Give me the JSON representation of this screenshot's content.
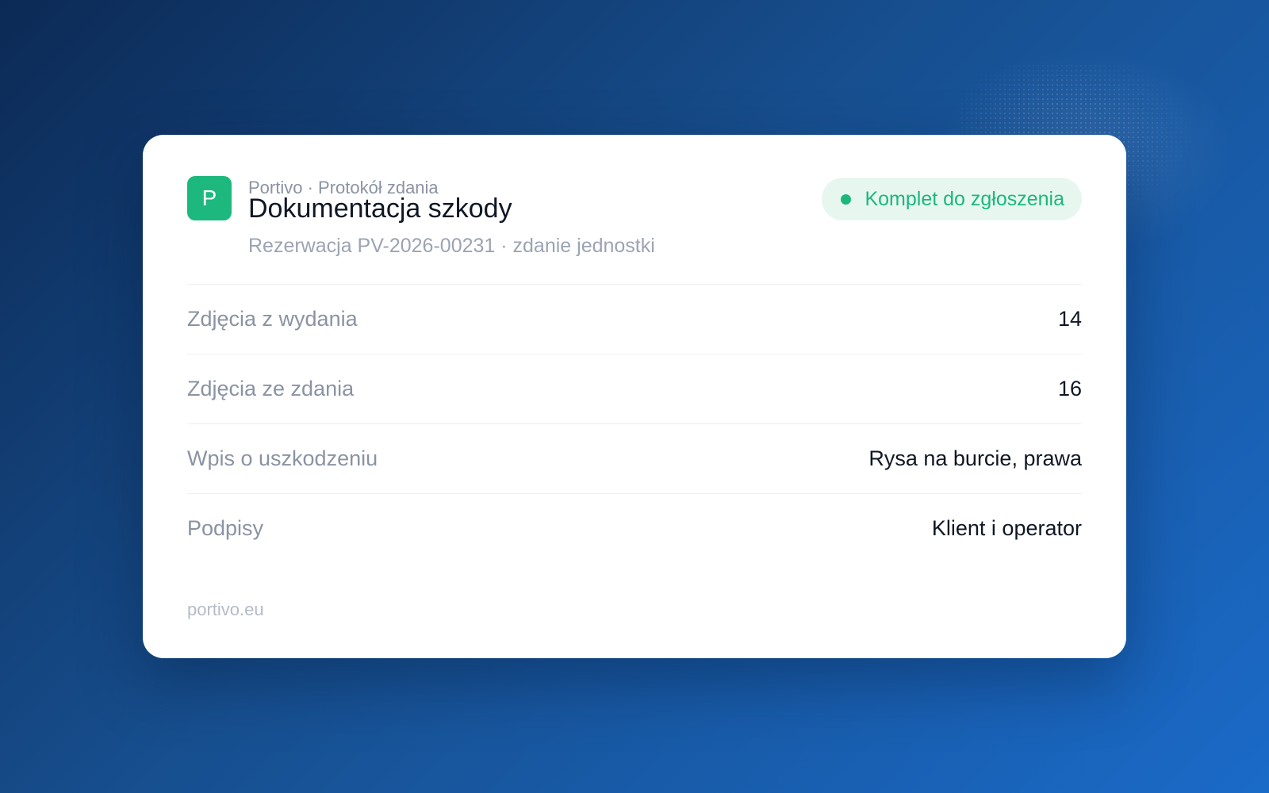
{
  "header": {
    "logo_letter": "P",
    "eyebrow": "Portivo · Protokół zdania",
    "title": "Dokumentacja szkody",
    "subtitle": "Rezerwacja PV-2026-00231 · zdanie jednostki",
    "status_badge": "Komplet do zgłoszenia"
  },
  "rows": [
    {
      "label": "Zdjęcia z wydania",
      "value": "14"
    },
    {
      "label": "Zdjęcia ze zdania",
      "value": "16"
    },
    {
      "label": "Wpis o uszkodzeniu",
      "value": "Rysa na burcie, prawa"
    },
    {
      "label": "Podpisy",
      "value": "Klient i operator"
    }
  ],
  "footer": {
    "domain": "portivo.eu"
  },
  "colors": {
    "accent": "#1db87e",
    "badge_bg": "#e7f7f0",
    "background_start": "#0c2a55",
    "background_end": "#1a6ac8"
  }
}
